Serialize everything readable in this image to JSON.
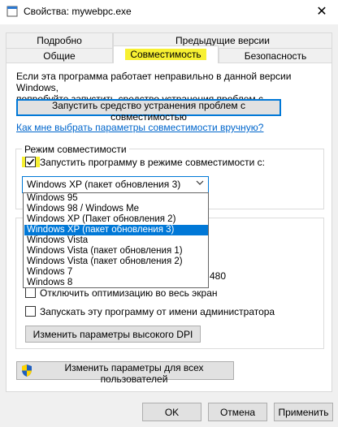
{
  "window": {
    "title": "Свойства: mywebpc.exe",
    "close_glyph": "✕"
  },
  "tabs": {
    "back": [
      "Подробно",
      "Предыдущие версии"
    ],
    "front": [
      "Общие",
      "Совместимость",
      "Безопасность"
    ],
    "active": "Совместимость"
  },
  "intro": {
    "line1": "Если эта программа работает неправильно в данной версии Windows,",
    "line2": "попробуйте запустить средство устранения проблем с совместимостью."
  },
  "buttons": {
    "troubleshoot": "Запустить средство устранения проблем с совместимостью",
    "dpi": "Изменить параметры высокого DPI",
    "all_users": "Изменить параметры для всех пользователей",
    "ok": "OK",
    "cancel": "Отмена",
    "apply": "Применить"
  },
  "help_link": "Как мне выбрать параметры совместимости вручную?",
  "compat_mode": {
    "group_title": "Режим совместимости",
    "checkbox_label": "Запустить программу в режиме совместимости с:",
    "checked": true,
    "selected": "Windows XP (пакет обновления 3)",
    "options": [
      "Windows 95",
      "Windows 98 / Windows Me",
      "Windows XP (Пакет обновления 2)",
      "Windows XP (пакет обновления 3)",
      "Windows Vista",
      "Windows Vista (пакет обновления 1)",
      "Windows Vista (пакет обновления 2)",
      "Windows 7",
      "Windows 8"
    ],
    "selected_index": 3
  },
  "settings": {
    "partial_visible": "480",
    "fullscreen_label": "Отключить оптимизацию во весь экран",
    "admin_label": "Запускать эту программу от имени администратора"
  },
  "colors": {
    "accent": "#0078d7",
    "highlight": "#f7f032",
    "link": "#0066cc"
  },
  "icons": {
    "app": "window-icon",
    "shield": "uac-shield-icon",
    "check": "check-icon"
  }
}
